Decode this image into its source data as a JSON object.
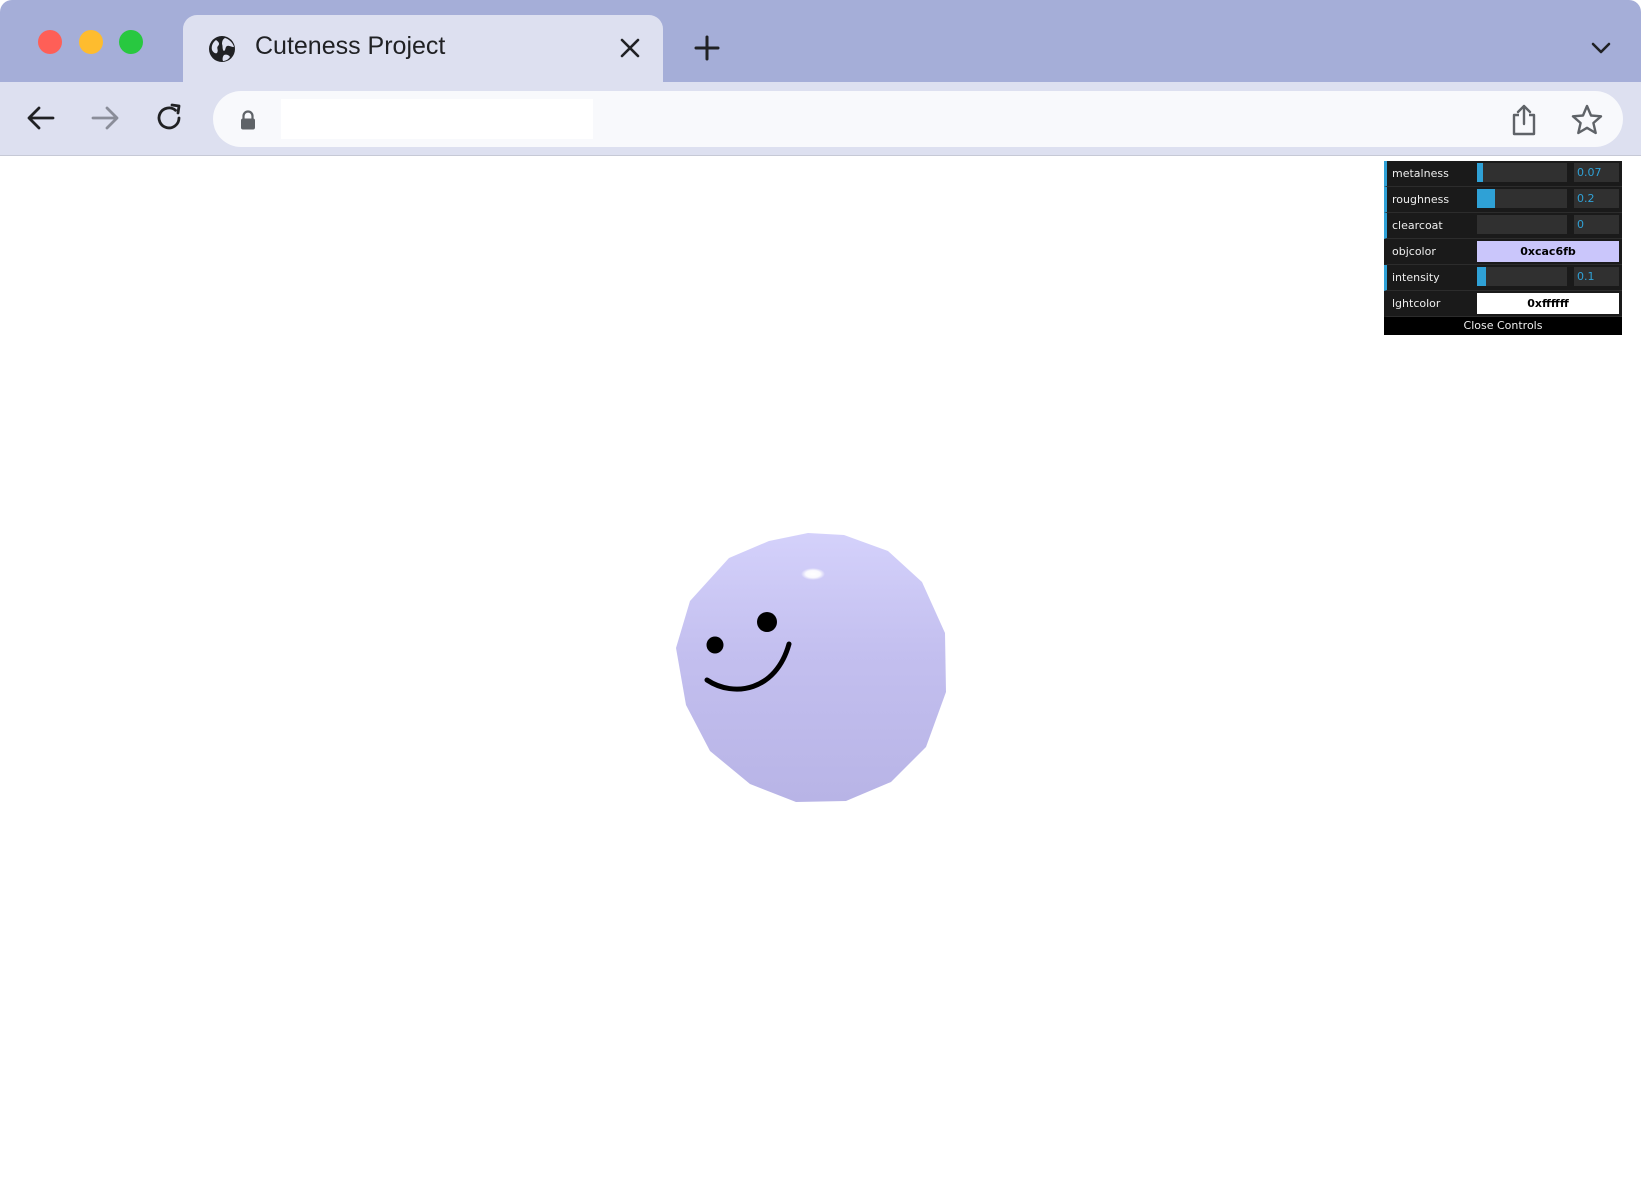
{
  "browser": {
    "tab_title": "Cuteness Project",
    "url": ""
  },
  "gui": {
    "controls": [
      {
        "key": "metalness",
        "label": "metalness",
        "value": "0.07",
        "fraction": 0.07
      },
      {
        "key": "roughness",
        "label": "roughness",
        "value": "0.2",
        "fraction": 0.2
      },
      {
        "key": "clearcoat",
        "label": "clearcoat",
        "value": "0",
        "fraction": 0
      }
    ],
    "objcolor": {
      "label": "objcolor",
      "value": "0xcac6fb",
      "swatch": "#cac6fb"
    },
    "intensity": {
      "label": "intensity",
      "value": "0.1",
      "fraction": 0.1
    },
    "lghtcolor": {
      "label": "lghtcolor",
      "value": "0xffffff",
      "swatch": "#ffffff"
    },
    "close_label": "Close Controls"
  },
  "scene": {
    "object_color": "#cac6fb",
    "face_color": "#000000"
  },
  "icons": {
    "tab": "globe-icon",
    "close": "close-icon",
    "new_tab": "plus-icon",
    "tab_menu": "chevron-down-icon",
    "back": "arrow-left-icon",
    "forward": "arrow-right-icon",
    "reload": "reload-icon",
    "lock": "lock-icon",
    "share": "share-icon",
    "bookmark": "star-icon"
  }
}
